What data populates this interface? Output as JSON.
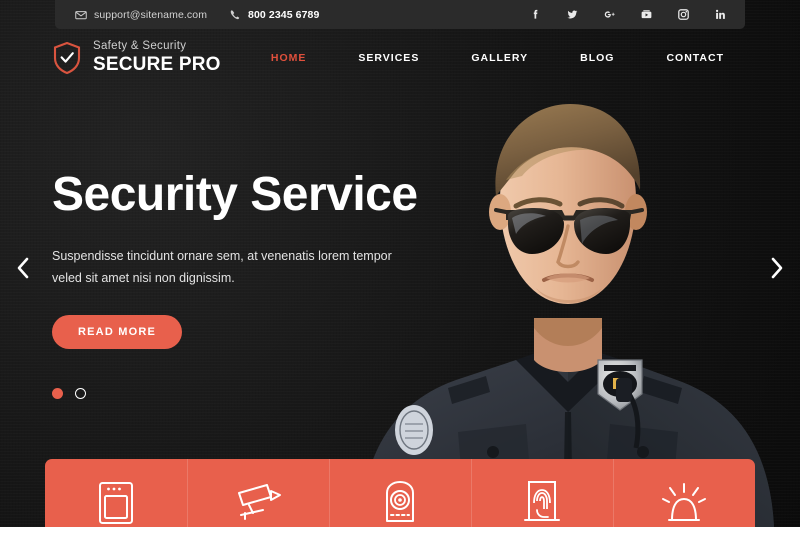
{
  "topbar": {
    "email": "support@sitename.com",
    "phone": "800 2345 6789",
    "email_icon": "envelope-icon",
    "phone_icon": "phone-icon",
    "social": [
      {
        "name": "facebook",
        "label": "f"
      },
      {
        "name": "twitter",
        "label": "t"
      },
      {
        "name": "google-plus",
        "label": "g+"
      },
      {
        "name": "youtube",
        "label": "yt"
      },
      {
        "name": "instagram",
        "label": "ig"
      },
      {
        "name": "linkedin",
        "label": "in"
      }
    ]
  },
  "brand": {
    "tagline": "Safety & Security",
    "name": "SECURE PRO",
    "icon": "shield-check-icon",
    "accent": "#e0503c"
  },
  "nav": {
    "items": [
      {
        "label": "HOME",
        "active": true
      },
      {
        "label": "SERVICES",
        "active": false
      },
      {
        "label": "GALLERY",
        "active": false
      },
      {
        "label": "BLOG",
        "active": false
      },
      {
        "label": "CONTACT",
        "active": false
      }
    ]
  },
  "slider": {
    "heading": "Security Service",
    "body": "Suspendisse tincidunt ornare sem, at venenatis lorem tempor veled sit amet nisi non dignissim.",
    "cta_label": "READ MORE",
    "prev_icon": "chevron-left-icon",
    "next_icon": "chevron-right-icon",
    "dots": [
      {
        "active": true
      },
      {
        "active": false
      }
    ]
  },
  "services": {
    "bar_color": "#e8604c",
    "items": [
      {
        "icon": "safe-vault-icon"
      },
      {
        "icon": "cctv-camera-icon"
      },
      {
        "icon": "alarm-panel-icon"
      },
      {
        "icon": "door-access-fingerprint-icon"
      },
      {
        "icon": "siren-light-icon"
      }
    ]
  }
}
